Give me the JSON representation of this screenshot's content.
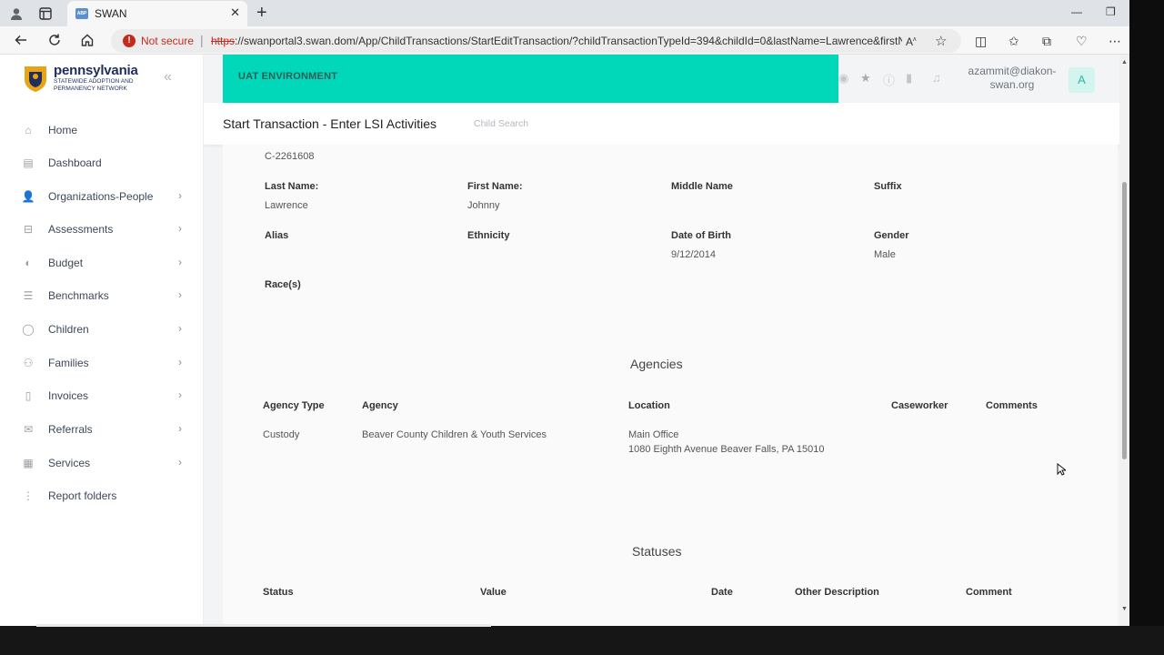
{
  "browser": {
    "tab_title": "SWAN",
    "favicon_text": "ABP",
    "security_label": "Not secure",
    "url_scheme": "https",
    "url_rest": "://swanportal3.swan.dom/App/ChildTransactions/StartEditTransaction/?childTransactionTypeId=394&childId=0&lastName=Lawrence&firstN..."
  },
  "sidebar": {
    "logo_title": "pennsylvania",
    "logo_subtitle": "STATEWIDE ADOPTION AND PERMANENCY NETWORK",
    "items": [
      {
        "label": "Home",
        "icon": "home-icon",
        "has_children": false
      },
      {
        "label": "Dashboard",
        "icon": "dashboard-icon",
        "has_children": false
      },
      {
        "label": "Organizations-People",
        "icon": "people-icon",
        "has_children": true
      },
      {
        "label": "Assessments",
        "icon": "inbox-icon",
        "has_children": true
      },
      {
        "label": "Budget",
        "icon": "piggy-bank-icon",
        "has_children": true
      },
      {
        "label": "Benchmarks",
        "icon": "list-icon",
        "has_children": true
      },
      {
        "label": "Children",
        "icon": "child-icon",
        "has_children": true
      },
      {
        "label": "Families",
        "icon": "family-icon",
        "has_children": true
      },
      {
        "label": "Invoices",
        "icon": "document-icon",
        "has_children": true
      },
      {
        "label": "Referrals",
        "icon": "referral-icon",
        "has_children": true
      },
      {
        "label": "Services",
        "icon": "services-icon",
        "has_children": true
      },
      {
        "label": "Report folders",
        "icon": "more-vertical-icon",
        "has_children": false
      }
    ]
  },
  "header": {
    "environment": "UAT ENVIRONMENT",
    "user_email": "azammit@diakon-swan.org",
    "user_email_line1": "azammit@diakon-",
    "user_email_line2": "swan.org",
    "avatar_letter": "A",
    "page_title": "Start Transaction - Enter LSI Activities",
    "child_search": "Child Search"
  },
  "child": {
    "id": "C-2261608",
    "last_name_label": "Last Name:",
    "last_name": "Lawrence",
    "first_name_label": "First Name:",
    "first_name": "Johnny",
    "middle_name_label": "Middle Name",
    "suffix_label": "Suffix",
    "alias_label": "Alias",
    "ethnicity_label": "Ethnicity",
    "dob_label": "Date of Birth",
    "dob": "9/12/2014",
    "gender_label": "Gender",
    "gender": "Male",
    "races_label": "Race(s)"
  },
  "agencies": {
    "title": "Agencies",
    "columns": [
      "Agency Type",
      "Agency",
      "Location",
      "Caseworker",
      "Comments"
    ],
    "rows": [
      {
        "type": "Custody",
        "agency": "Beaver County Children & Youth Services",
        "location_line1": "Main Office",
        "location_line2": "1080 Eighth Avenue Beaver Falls, PA 15010"
      }
    ]
  },
  "statuses": {
    "title": "Statuses",
    "columns": [
      "Status",
      "Value",
      "Date",
      "Other Description",
      "Comment"
    ]
  },
  "colors": {
    "uat_banner": "#00d8b9",
    "not_secure": "#c42b1c",
    "brand_navy": "#1f2f5c"
  }
}
